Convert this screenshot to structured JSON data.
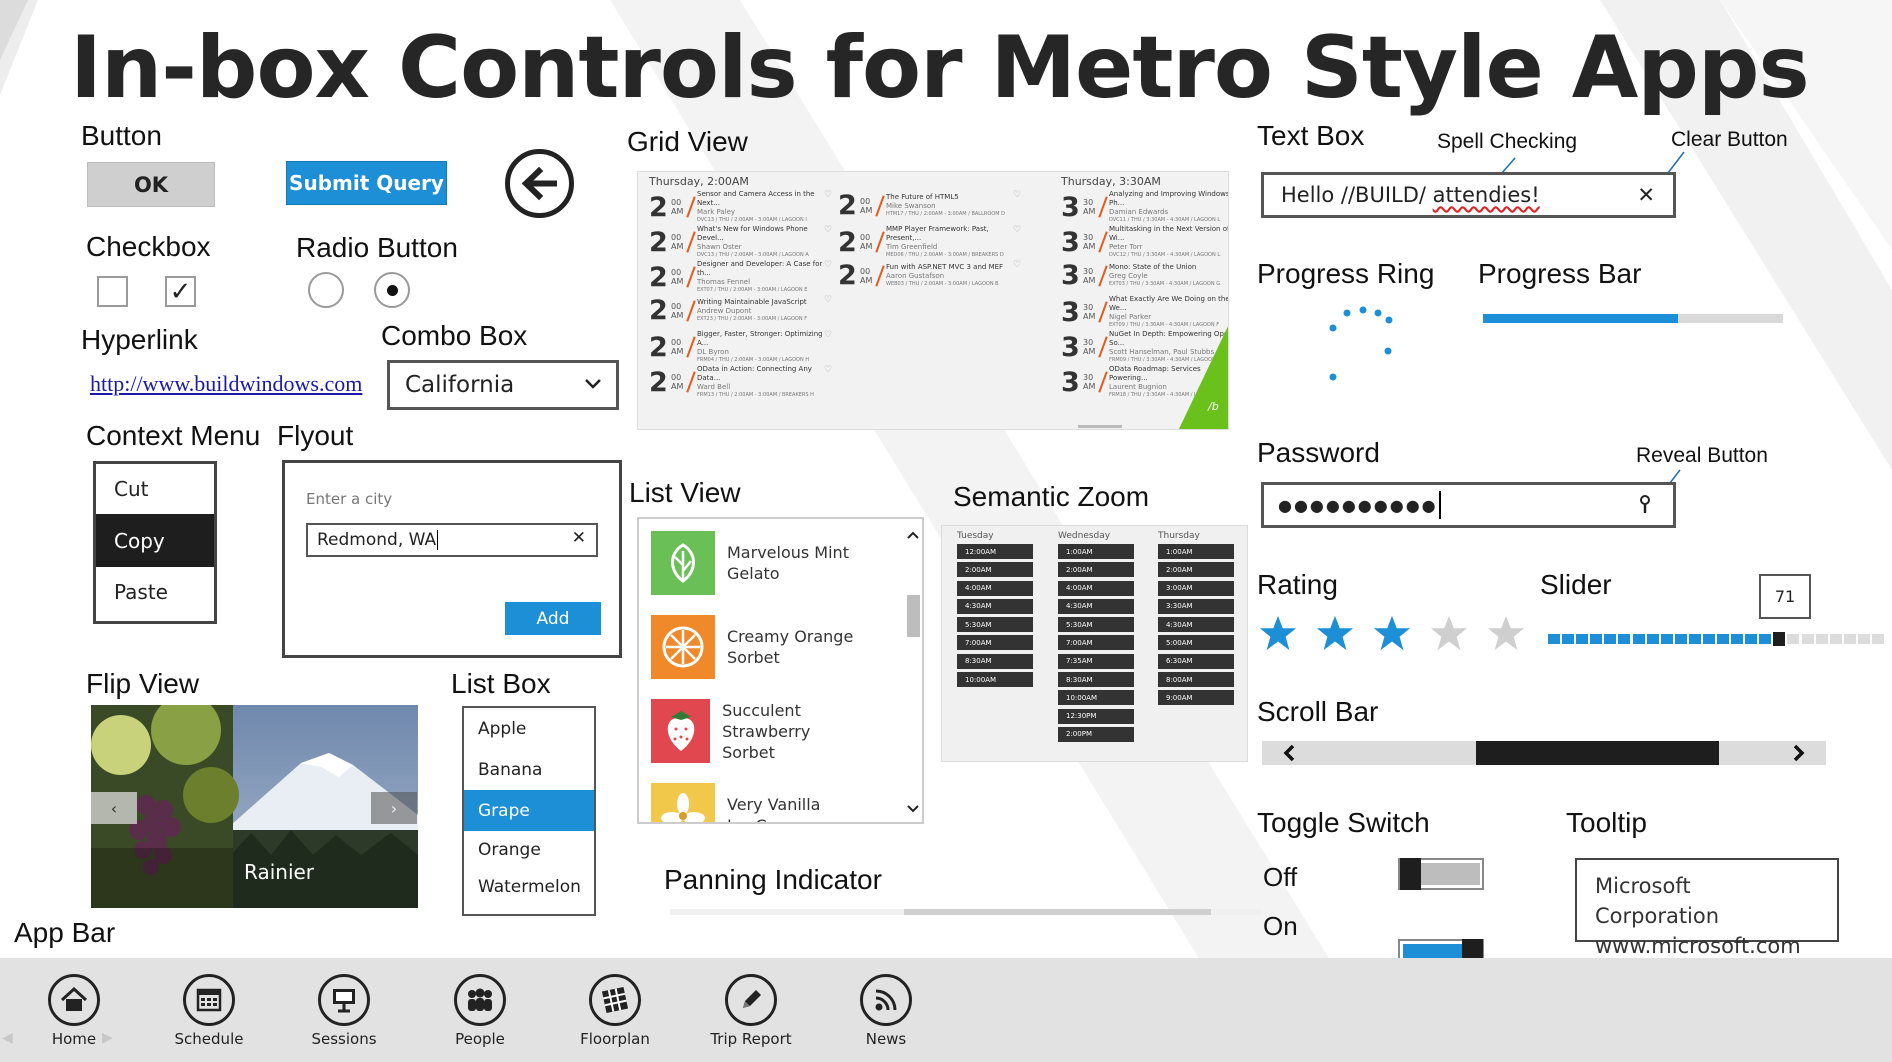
{
  "title": "In-box Controls for Metro Style Apps",
  "sections": {
    "button": "Button",
    "checkbox": "Checkbox",
    "radio": "Radio Button",
    "hyperlink": "Hyperlink",
    "combo": "Combo Box",
    "context_menu": "Context Menu",
    "flyout": "Flyout",
    "flip_view": "Flip View",
    "list_box": "List Box",
    "app_bar": "App Bar",
    "grid_view": "Grid View",
    "list_view": "List View",
    "semantic_zoom": "Semantic Zoom",
    "panning_indicator": "Panning Indicator",
    "text_box": "Text Box",
    "progress_ring": "Progress Ring",
    "progress_bar": "Progress Bar",
    "password": "Password",
    "rating": "Rating",
    "slider": "Slider",
    "scroll_bar": "Scroll Bar",
    "toggle_switch": "Toggle Switch",
    "tooltip": "Tooltip"
  },
  "notes": {
    "spell_checking": "Spell Checking",
    "clear_button": "Clear Button",
    "reveal_button": "Reveal Button"
  },
  "buttons": {
    "ok": "OK",
    "submit": "Submit Query"
  },
  "hyperlink": {
    "url": "http://www.buildwindows.com"
  },
  "combo": {
    "value": "California"
  },
  "context_menu": {
    "items": [
      "Cut",
      "Copy",
      "Paste"
    ],
    "selected": "Copy"
  },
  "flyout": {
    "placeholder": "Enter a city",
    "value": "Redmond, WA",
    "button": "Add"
  },
  "flip_view": {
    "caption": "Rainier"
  },
  "list_box": {
    "items": [
      "Apple",
      "Banana",
      "Grape",
      "Orange",
      "Watermelon"
    ],
    "selected": "Grape"
  },
  "grid_view": {
    "col1_header": "Thursday, 2:00AM",
    "col2_header": "Thursday, 3:30AM",
    "tile_logo": "/b",
    "col1": [
      {
        "h": "2",
        "m": "00",
        "t": "Sensor and Camera Access in the Next...",
        "s": "Mark Paley",
        "d": "DVC13 / THU / 2:00AM - 3:00AM / LAGOON I"
      },
      {
        "h": "2",
        "m": "00",
        "t": "What's New for Windows Phone Devel...",
        "s": "Shawn Oster",
        "d": "DVC13 / THU / 2:00AM - 3:00AM / LAGOON A"
      },
      {
        "h": "2",
        "m": "00",
        "t": "Designer and Developer: A Case for th...",
        "s": "Thomas Fennel",
        "d": "EXT07 / THU / 2:00AM - 3:00AM / LAGOON E"
      },
      {
        "h": "2",
        "m": "00",
        "t": "Writing Maintainable JavaScript",
        "s": "Andrew Dupont",
        "d": "EXT23 / THU / 2:00AM - 3:00AM / LAGOON F"
      },
      {
        "h": "2",
        "m": "00",
        "t": "Bigger, Faster, Stronger: Optimizing A...",
        "s": "DL Byron",
        "d": "FRM04 / THU / 2:00AM - 3:00AM / LAGOON H"
      },
      {
        "h": "2",
        "m": "00",
        "t": "OData in Action: Connecting Any Data...",
        "s": "Ward Bell",
        "d": "FRM13 / THU / 2:00AM - 3:00AM / BREAKERS H"
      }
    ],
    "col2": [
      {
        "h": "2",
        "m": "00",
        "t": "The Future of HTML5",
        "s": "Mike Swanson",
        "d": "HTM17 / THU / 2:00AM - 3:00AM / BALLROOM D"
      },
      {
        "h": "2",
        "m": "00",
        "t": "MMP Player Framework: Past, Present,...",
        "s": "Tim Greenfield",
        "d": "MED06 / THU / 2:00AM - 3:00AM / BREAKERS D"
      },
      {
        "h": "2",
        "m": "00",
        "t": "Fun with ASP.NET MVC 3 and MEF",
        "s": "Aaron Gustafson",
        "d": "WEB03 / THU / 2:00AM - 3:00AM / LAGOON B"
      }
    ],
    "col3": [
      {
        "h": "3",
        "m": "30",
        "t": "Analyzing and Improving Windows Ph...",
        "s": "Damian Edwards",
        "d": "DVC11 / THU / 3:30AM - 4:30AM / LAGOON L"
      },
      {
        "h": "3",
        "m": "30",
        "t": "Multitasking in the Next Version of Wi...",
        "s": "Peter Torr",
        "d": "DVC12 / THU / 3:30AM - 4:30AM / LAGOON L"
      },
      {
        "h": "3",
        "m": "30",
        "t": "Mono: State of the Union",
        "s": "Greg Coyle",
        "d": "EXT03 / THU / 3:30AM - 4:30AM / LAGOON G"
      },
      {
        "h": "3",
        "m": "30",
        "t": "What Exactly Are We Doing on the We...",
        "s": "Nigel Parker",
        "d": "EXT09 / THU / 3:30AM - 4:30AM / LAGOON F"
      },
      {
        "h": "3",
        "m": "30",
        "t": "NuGet In Depth: Empowering Open So...",
        "s": "Scott Hanselman, Paul Stubbs",
        "d": "FRM09 / THU / 3:30AM - 4:30AM / LAGOON H"
      },
      {
        "h": "3",
        "m": "30",
        "t": "OData Roadmap: Services Powering...",
        "s": "Laurent Bugnion",
        "d": "FRM18 / THU / 3:30AM - 4:30AM / LAGOON A"
      }
    ]
  },
  "list_view": {
    "items": [
      {
        "l1": "Marvelous Mint",
        "l2": "Gelato",
        "color": "#6bbf57"
      },
      {
        "l1": "Creamy Orange",
        "l2": "Sorbet",
        "color": "#f0892a"
      },
      {
        "l1": "Succulent Strawberry",
        "l2": "Sorbet",
        "color": "#e0474e"
      },
      {
        "l1": "Very Vanilla",
        "l2": "Ice Cream",
        "color": "#f2c84b"
      }
    ]
  },
  "semantic_zoom": {
    "columns": [
      {
        "day": "Tuesday",
        "slots": [
          "12:00AM",
          "2:00AM",
          "4:00AM",
          "4:30AM",
          "5:30AM",
          "7:00AM",
          "8:30AM",
          "10:00AM"
        ]
      },
      {
        "day": "Wednesday",
        "slots": [
          "1:00AM",
          "2:00AM",
          "4:00AM",
          "4:30AM",
          "5:30AM",
          "7:00AM",
          "7:35AM",
          "8:30AM",
          "10:00AM",
          "12:30PM",
          "2:00PM"
        ]
      },
      {
        "day": "Thursday",
        "slots": [
          "1:00AM",
          "2:00AM",
          "3:00AM",
          "3:30AM",
          "4:30AM",
          "5:00AM",
          "6:30AM",
          "8:00AM",
          "9:00AM"
        ]
      }
    ]
  },
  "text_box": {
    "value_plain": "Hello //BUILD/ ",
    "value_misspelled": "attendies!"
  },
  "password": {
    "value": "●●●●●●●●●●"
  },
  "progress_bar": {
    "value": 0.65
  },
  "rating": {
    "value": 3,
    "max": 5
  },
  "slider": {
    "value": "71",
    "fraction": 0.71
  },
  "scroll_bar": {
    "thumb_start": 0.38,
    "thumb_end": 0.81
  },
  "toggles": [
    {
      "label": "Off",
      "state": false
    },
    {
      "label": "On",
      "state": true
    }
  ],
  "tooltip": {
    "line1": "Microsoft Corporation",
    "line2": "www.microsoft.com"
  },
  "app_bar": {
    "items": [
      {
        "label": "Home",
        "icon": "home-icon"
      },
      {
        "label": "Schedule",
        "icon": "calendar-icon"
      },
      {
        "label": "Sessions",
        "icon": "presentation-icon"
      },
      {
        "label": "People",
        "icon": "people-icon"
      },
      {
        "label": "Floorplan",
        "icon": "floorplan-icon"
      },
      {
        "label": "Trip Report",
        "icon": "pencil-icon"
      },
      {
        "label": "News",
        "icon": "rss-icon"
      }
    ]
  },
  "colors": {
    "accent": "#1c8fd6",
    "dark": "#222222",
    "green": "#6ac11b"
  }
}
